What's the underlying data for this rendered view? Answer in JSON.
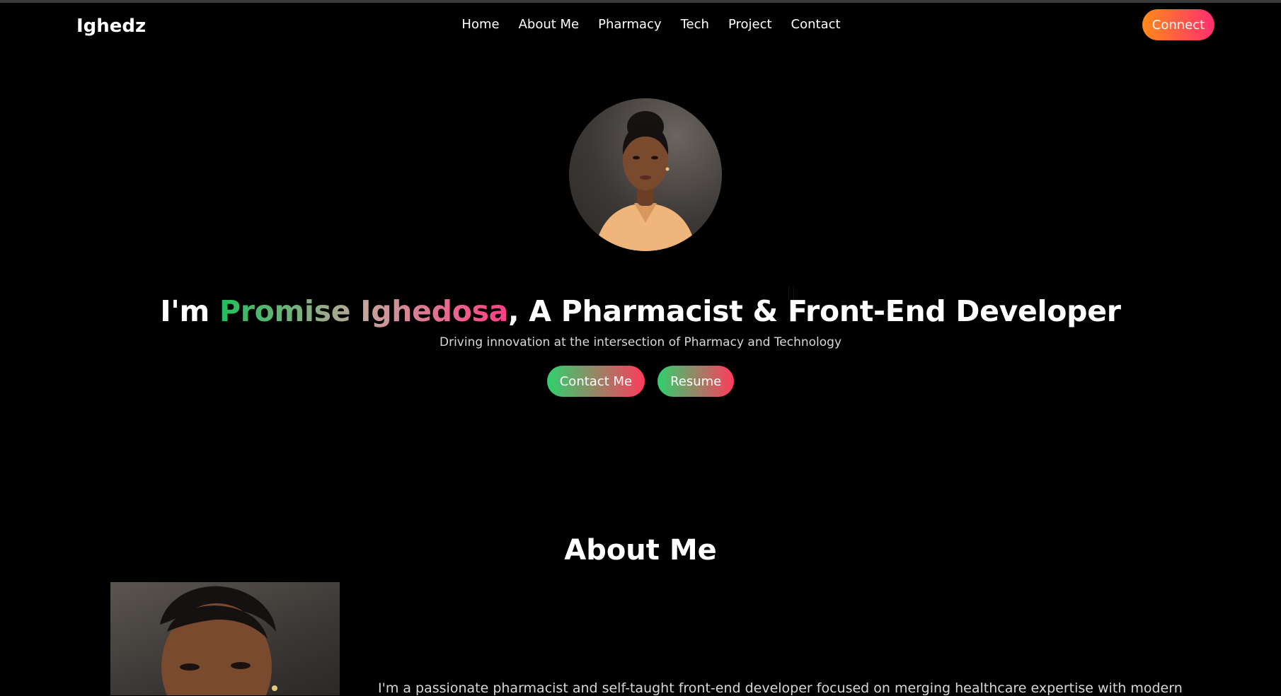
{
  "brand": {
    "logo": "Ighedz"
  },
  "nav": {
    "links": [
      "Home",
      "About Me",
      "Pharmacy",
      "Tech",
      "Project",
      "Contact"
    ],
    "connect_label": "Connect"
  },
  "hero": {
    "title_prefix": "I'm ",
    "name": "Promise Ighedosa",
    "title_suffix": ", A Pharmacist & Front-End Developer",
    "subtitle": "Driving innovation at the intersection of Pharmacy and Technology",
    "contact_label": "Contact Me",
    "resume_label": "Resume"
  },
  "about": {
    "title": "About Me",
    "text": "I'm a passionate pharmacist and self-taught front-end developer focused on merging healthcare expertise with modern"
  },
  "colors": {
    "background": "#000000",
    "connect_gradient": [
      "#ff8a1a",
      "#ff2e6e"
    ],
    "button_gradient": [
      "#2fd06e",
      "#ff3b5c"
    ],
    "name_gradient": [
      "#1fc05a",
      "#c3a59b",
      "#ff3f86"
    ]
  }
}
